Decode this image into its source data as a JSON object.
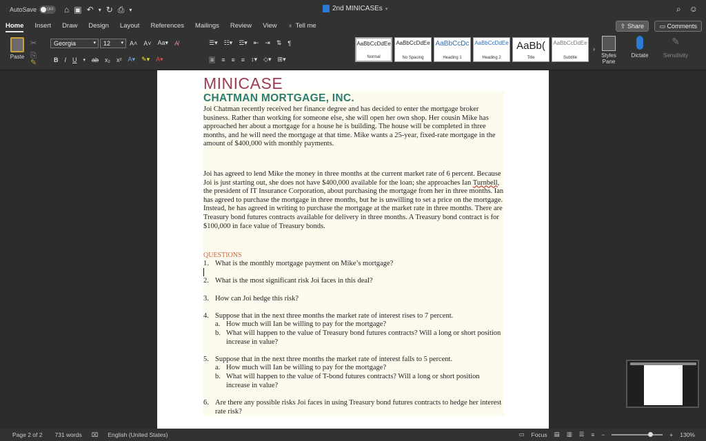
{
  "titlebar": {
    "autosave_label": "AutoSave",
    "autosave_state": "OFF",
    "document_title": "2nd MINICASEs"
  },
  "tabs": [
    "Home",
    "Insert",
    "Draw",
    "Design",
    "Layout",
    "References",
    "Mailings",
    "Review",
    "View"
  ],
  "tell_me": "Tell me",
  "share_label": "Share",
  "comments_label": "Comments",
  "ribbon": {
    "paste_label": "Paste",
    "font_name": "Georgia",
    "font_size": "12",
    "styles": [
      {
        "sample": "AaBbCcDdEe",
        "name": "Normal"
      },
      {
        "sample": "AaBbCcDdEe",
        "name": "No Spacing"
      },
      {
        "sample": "AaBbCcDc",
        "name": "Heading 1"
      },
      {
        "sample": "AaBbCcDdEe",
        "name": "Heading 2"
      },
      {
        "sample": "AaBb(",
        "name": "Title"
      },
      {
        "sample": "AaBbCcDdEe",
        "name": "Subtitle"
      }
    ],
    "styles_pane_label": "Styles Pane",
    "dictate_label": "Dictate",
    "sensitivity_label": "Sensitivity"
  },
  "document": {
    "heading": "MINICASE",
    "company": "CHATMAN MORTGAGE, INC.",
    "paragraph1": "Joi Chatman recently received her finance degree and has decided to enter the mortgage broker business. Rather than working for someone else, she will open her own shop. Her cousin Mike has approached her about a mortgage for a house he is building. The house will be completed in three months, and he will need the mortgage at that time. Mike wants a 25-year, fixed-rate mortgage in the amount of $400,000 with monthly payments.",
    "paragraph2_a": "Joi has agreed to lend Mike the money in three months at the current market rate of 6 percent. Because Joi is just starting out, she does not have $400,000 available for the loan; she approaches Ian ",
    "paragraph2_name": "Turnbell",
    "paragraph2_b": ", the president of IT Insurance Corporation, about purchasing the mortgage from her in three months. Ian has agreed to purchase the mortgage in three months, but he is unwilling to set a price on the mortgage. Instead, he has agreed in writing to purchase the mortgage at the market rate in three months. There are Treasury bond futures contracts available for delivery in three months. A Treasury bond contract is for $100,000 in face value of Treasury bonds.",
    "questions_heading": "QUESTIONS",
    "questions": [
      {
        "num": "1.",
        "text": "What is the monthly mortgage payment on Mike’s mortgage?"
      },
      {
        "num": "2.",
        "text": "What is the most significant risk Joi faces in this deal?"
      },
      {
        "num": "3.",
        "text": "How can Joi hedge this risk?"
      },
      {
        "num": "4.",
        "text": "Suppose that in the next three months the market rate of interest rises to 7 percent."
      },
      {
        "num": "5.",
        "text": "Suppose that in the next three months the market rate of interest falls to 5 percent."
      },
      {
        "num": "6.",
        "text": "Are there any possible risks Joi faces in using Treasury bond futures contracts to hedge her interest rate risk?"
      }
    ],
    "q4_subs": [
      {
        "num": "a.",
        "text": "How much will Ian be willing to pay for the mortgage?"
      },
      {
        "num": "b.",
        "text": "What will happen to the value of Treasury bond futures contracts? Will a long or short position increase in value?"
      }
    ],
    "q5_subs": [
      {
        "num": "a.",
        "text": "How much will Ian be willing to pay for the mortgage?"
      },
      {
        "num": "b.",
        "text": "What will happen to the value of T-bond futures contracts? Will a long or short position increase in value?"
      }
    ]
  },
  "status": {
    "page": "Page 2 of 2",
    "words": "731 words",
    "language": "English (United States)",
    "focus": "Focus",
    "zoom": "130%",
    "zoom_fraction": 0.75
  },
  "colors": {
    "heading": "#9c3b52",
    "company": "#2e7d72",
    "questions": "#c8683e",
    "case_bg": "#fdfaee"
  }
}
